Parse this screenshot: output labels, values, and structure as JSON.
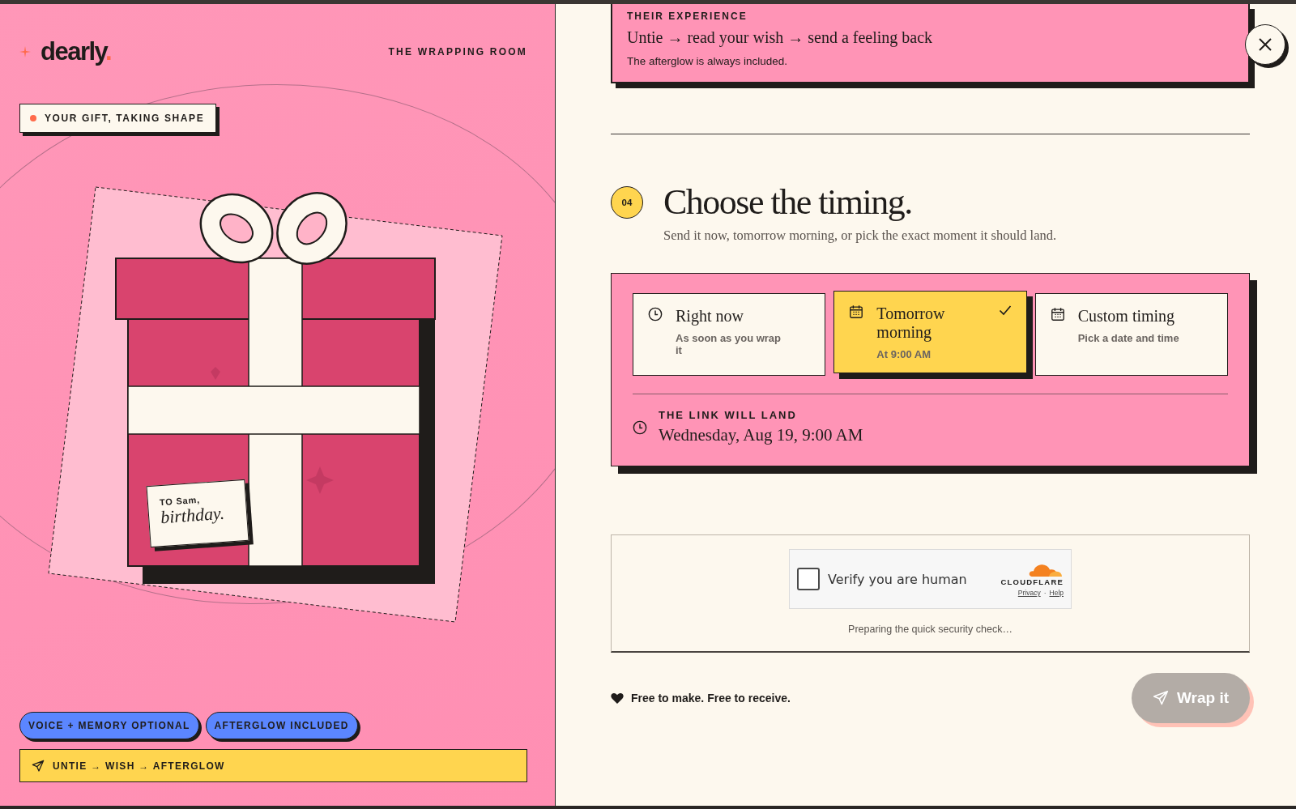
{
  "brand": {
    "logo": "dearly",
    "logo_dot": "."
  },
  "left": {
    "room_label": "THE WRAPPING ROOM",
    "status_badge": "YOUR GIFT, TAKING SHAPE",
    "gift_tag": {
      "to": "TO Sam,",
      "occasion": "birthday."
    },
    "pills": [
      "VOICE + MEMORY OPTIONAL",
      "AFTERGLOW INCLUDED"
    ],
    "flow_bar": "UNTIE → WISH → AFTERGLOW"
  },
  "experience_card": {
    "eyebrow": "THEIR EXPERIENCE",
    "title": "Untie → read your wish → send a feeling back",
    "note": "The afterglow is always included."
  },
  "step": {
    "number": "04",
    "heading": "Choose the timing.",
    "subtitle": "Send it now, tomorrow morning, or pick the exact moment it should land."
  },
  "timing_options": [
    {
      "kind": "immediate",
      "title": "Right now",
      "detail": "As soon as you wrap it",
      "selected": false
    },
    {
      "kind": "preset",
      "title": "Tomorrow morning",
      "detail": "At 9:00 AM",
      "selected": true
    },
    {
      "kind": "custom",
      "title": "Custom timing",
      "detail": "Pick a date and time",
      "selected": false
    }
  ],
  "landing": {
    "label": "THE LINK WILL LAND",
    "value": "Wednesday, Aug 19, 9:00 AM"
  },
  "captcha": {
    "label": "Verify you are human",
    "checked": false,
    "provider": "CLOUDFLARE",
    "links": [
      "Privacy",
      "Help"
    ],
    "separator": "·",
    "status": "Preparing the quick security check…"
  },
  "footer": {
    "note": "Free to make. Free to receive.",
    "button": {
      "label": "Wrap it",
      "disabled": true
    }
  }
}
